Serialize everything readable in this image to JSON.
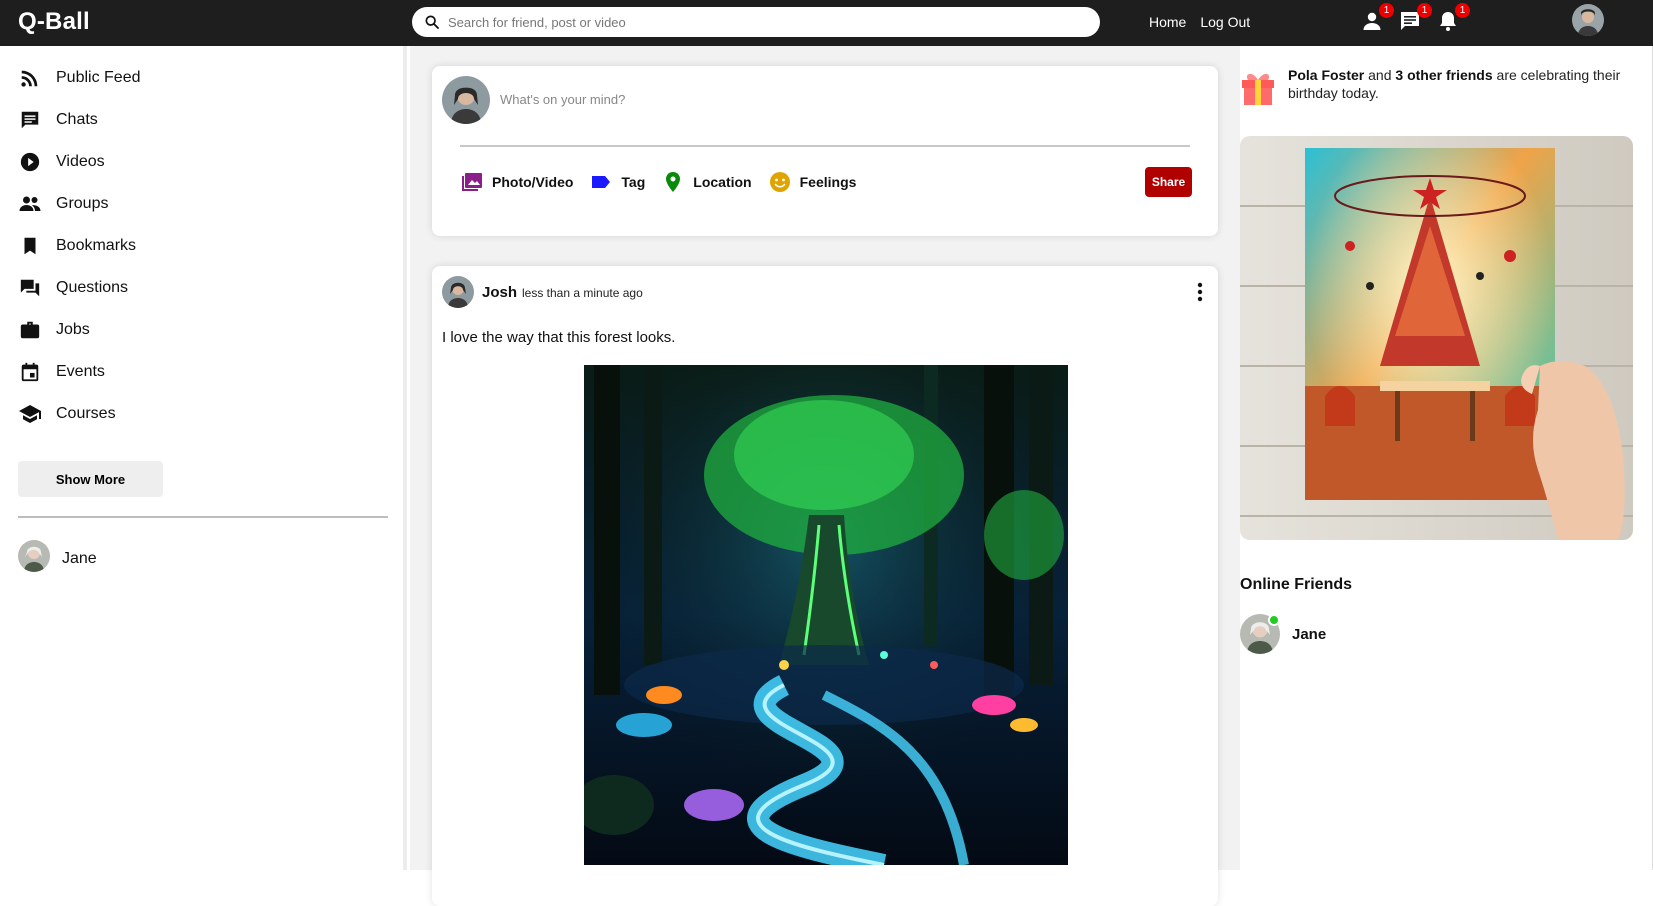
{
  "header": {
    "logo": "Q-Ball",
    "search_placeholder": "Search for friend, post or video",
    "links": [
      "Home",
      "Log Out"
    ],
    "badges": {
      "friends": "1",
      "messages": "1",
      "notifications": "1"
    }
  },
  "sidebar": {
    "items": [
      {
        "label": "Public Feed",
        "icon": "rss-icon"
      },
      {
        "label": "Chats",
        "icon": "chat-icon"
      },
      {
        "label": "Videos",
        "icon": "play-circle-icon"
      },
      {
        "label": "Groups",
        "icon": "group-icon"
      },
      {
        "label": "Bookmarks",
        "icon": "bookmark-icon"
      },
      {
        "label": "Questions",
        "icon": "question-answer-icon"
      },
      {
        "label": "Jobs",
        "icon": "briefcase-icon"
      },
      {
        "label": "Events",
        "icon": "calendar-icon"
      },
      {
        "label": "Courses",
        "icon": "school-icon"
      }
    ],
    "show_more": "Show More",
    "friends": [
      {
        "name": "Jane"
      }
    ]
  },
  "share": {
    "placeholder": "What's on your mind?",
    "options": [
      {
        "label": "Photo/Video",
        "icon": "photo-library-icon",
        "color": "#8b1e8b"
      },
      {
        "label": "Tag",
        "icon": "label-icon",
        "color": "#1a1aff"
      },
      {
        "label": "Location",
        "icon": "location-pin-icon",
        "color": "#0a8a0a"
      },
      {
        "label": "Feelings",
        "icon": "emoji-icon",
        "color": "#e0a400"
      }
    ],
    "share_button": "Share"
  },
  "post": {
    "author": "Josh",
    "time": "less than a minute ago",
    "text": "I love the way that this forest looks."
  },
  "rightbar": {
    "birthday": {
      "name": "Pola Foster",
      "middle": " and ",
      "others": "3 other friends",
      "rest": " are celebrating their birthday today."
    },
    "online_title": "Online Friends",
    "online_friends": [
      {
        "name": "Jane"
      }
    ]
  },
  "colors": {
    "topbar": "#1e1e1e",
    "accent_red": "#b00000",
    "online": "#22cc22"
  }
}
